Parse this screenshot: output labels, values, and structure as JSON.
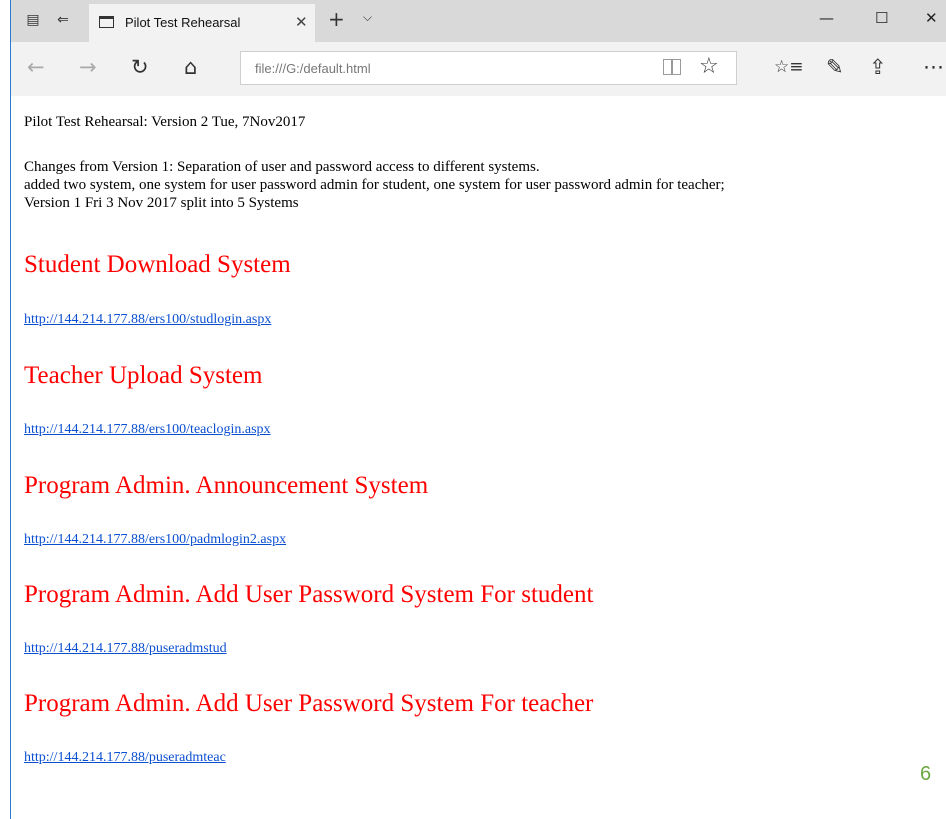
{
  "browser": {
    "tab_title": "Pilot Test Rehearsal",
    "address": "file:///G:/default.html",
    "tab_close_glyph": "✕",
    "new_tab_glyph": "+",
    "tab_menu_glyph": "⌵",
    "window_buttons": {
      "minimize": "—",
      "maximize": "☐",
      "close": "✕"
    },
    "nav_glyphs": {
      "back": "←",
      "forward": "→",
      "refresh": "↻",
      "home": "⌂",
      "favorite": "☆",
      "favorites_hub": "☆≡",
      "notes": "✎",
      "share": "⇪",
      "more": "⋯"
    }
  },
  "page": {
    "heading_line": "Pilot Test Rehearsal: Version 2 Tue, 7Nov2017",
    "changes_lines": [
      "Changes from Version 1: Separation of user and password access to different systems.",
      "added two system, one system for user password admin for student, one system for user password admin for teacher;",
      "Version 1 Fri 3 Nov 2017 split into 5 Systems"
    ],
    "sections": [
      {
        "title": "Student Download System",
        "link": "http://144.214.177.88/ers100/studlogin.aspx"
      },
      {
        "title": "Teacher Upload System",
        "link": "http://144.214.177.88/ers100/teaclogin.aspx"
      },
      {
        "title": "Program Admin. Announcement System",
        "link": "http://144.214.177.88/ers100/padmlogin2.aspx"
      },
      {
        "title": "Program Admin. Add User Password System For student",
        "link": "http://144.214.177.88/puseradmstud"
      },
      {
        "title": "Program Admin. Add User Password System For teacher",
        "link": "http://144.214.177.88/puseradmteac"
      }
    ],
    "page_number": "6"
  },
  "colors": {
    "section_title": "#ff0000",
    "link": "#0b4fd1",
    "page_number": "#6aa841",
    "window_edge": "#2b7bd4"
  }
}
